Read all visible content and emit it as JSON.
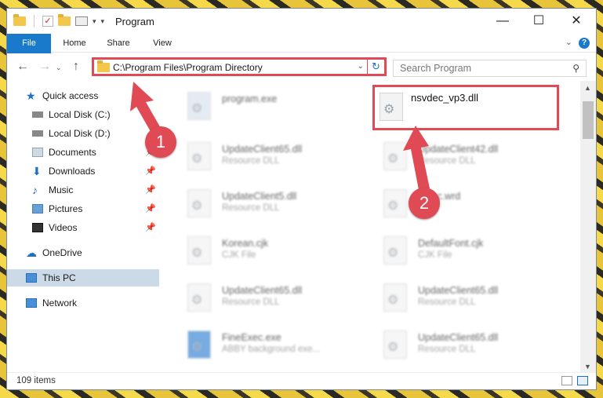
{
  "window": {
    "title": "Program"
  },
  "ribbon": {
    "tabs": [
      "File",
      "Home",
      "Share",
      "View"
    ]
  },
  "address": {
    "path": "C:\\Program Files\\Program Directory"
  },
  "search": {
    "placeholder": "Search Program"
  },
  "sidebar": {
    "items": [
      {
        "label": "Quick access",
        "icon": "star-icon"
      },
      {
        "label": "Local Disk (C:)",
        "icon": "drive-icon"
      },
      {
        "label": "Local Disk (D:)",
        "icon": "drive-icon"
      },
      {
        "label": "Documents",
        "icon": "documents-icon"
      },
      {
        "label": "Downloads",
        "icon": "download-icon"
      },
      {
        "label": "Music",
        "icon": "music-icon"
      },
      {
        "label": "Pictures",
        "icon": "pictures-icon"
      },
      {
        "label": "Videos",
        "icon": "videos-icon"
      },
      {
        "label": "OneDrive",
        "icon": "cloud-icon"
      },
      {
        "label": "This PC",
        "icon": "computer-icon"
      },
      {
        "label": "Network",
        "icon": "network-icon"
      }
    ]
  },
  "files": [
    {
      "name": "program.exe",
      "desc": ""
    },
    {
      "name": "nsvdec_vp3.dll",
      "desc": ""
    },
    {
      "name": "UpdateClient65.dll",
      "desc": "Resource DLL"
    },
    {
      "name": "UpdateClient42.dll",
      "desc": "Resource DLL"
    },
    {
      "name": "UpdateClient5.dll",
      "desc": "Resource DLL"
    },
    {
      "name": "Aplsc.wrd",
      "desc": ""
    },
    {
      "name": "Korean.cjk",
      "desc": "CJK File"
    },
    {
      "name": "DefaultFont.cjk",
      "desc": "CJK File"
    },
    {
      "name": "UpdateClient65.dll",
      "desc": "Resource DLL"
    },
    {
      "name": "UpdateClient65.dll",
      "desc": "Resource DLL"
    },
    {
      "name": "FineExec.exe",
      "desc": "ABBY background exe..."
    },
    {
      "name": "UpdateClient65.dll",
      "desc": "Resource DLL"
    }
  ],
  "status": {
    "items": "109 items"
  },
  "annotations": {
    "badge1": "1",
    "badge2": "2"
  },
  "colors": {
    "accent": "#1979ca",
    "highlight": "#e04a55"
  }
}
